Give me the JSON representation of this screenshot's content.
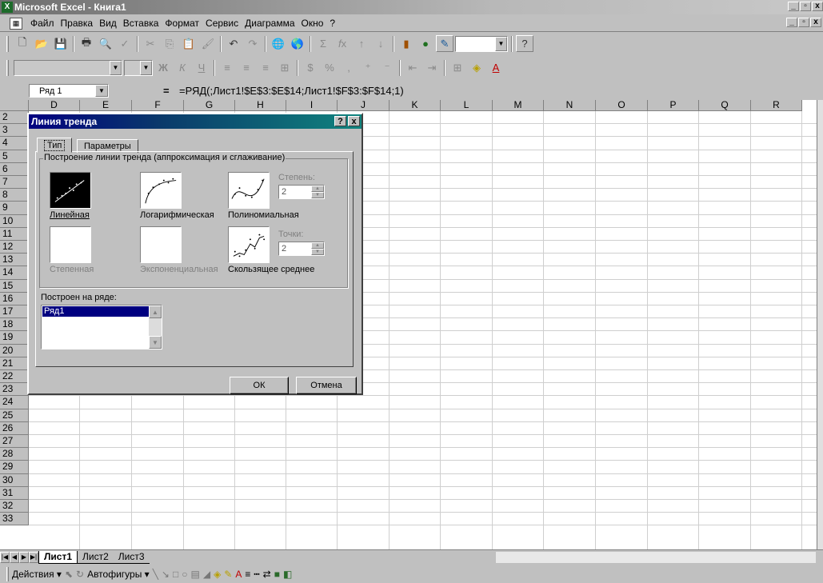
{
  "window": {
    "title": "Microsoft Excel - Книга1",
    "win_buttons": [
      "_",
      "▫",
      "x"
    ],
    "doc_buttons": [
      "_",
      "▫",
      "x"
    ]
  },
  "menu": [
    "Файл",
    "Правка",
    "Вид",
    "Вставка",
    "Формат",
    "Сервис",
    "Диаграмма",
    "Окно",
    "?"
  ],
  "formula_bar": {
    "name_box": "Ряд 1",
    "equals": "=",
    "formula": "=РЯД(;Лист1!$E$3:$E$14;Лист1!$F$3:$F$14;1)"
  },
  "toolbar2": {
    "bold": "Ж",
    "italic": "К",
    "underline": "Ч",
    "percent": "%",
    "comma": ","
  },
  "columns": [
    "D",
    "E",
    "F",
    "G",
    "H",
    "I",
    "J",
    "K",
    "L",
    "M",
    "N",
    "O",
    "P",
    "Q",
    "R"
  ],
  "rows": [
    "2",
    "3",
    "4",
    "5",
    "6",
    "7",
    "8",
    "9",
    "10",
    "11",
    "12",
    "13",
    "14",
    "15",
    "16",
    "17",
    "18",
    "19",
    "20",
    "21",
    "22",
    "23",
    "24",
    "25",
    "26",
    "27",
    "28",
    "29",
    "30",
    "31",
    "32",
    "33"
  ],
  "sheet_tabs": [
    "Лист1",
    "Лист2",
    "Лист3"
  ],
  "drawing_bar": {
    "actions": "Действия ▾",
    "autoshapes": "Автофигуры ▾"
  },
  "dialog": {
    "title": "Линия тренда",
    "help_btn": "?",
    "close_btn": "x",
    "tabs": [
      "Тип",
      "Параметры"
    ],
    "group_label": "Построение линии тренда (аппроксимация и сглаживание)",
    "types": [
      {
        "label": "Линейная",
        "selected": true,
        "enabled": true
      },
      {
        "label": "Логарифмическая",
        "selected": false,
        "enabled": true
      },
      {
        "label": "Полиномиальная",
        "selected": false,
        "enabled": true
      },
      {
        "label": "Степенная",
        "selected": false,
        "enabled": false
      },
      {
        "label": "Экспоненциальная",
        "selected": false,
        "enabled": false
      },
      {
        "label": "Скользящее среднее",
        "selected": false,
        "enabled": true
      }
    ],
    "degree": {
      "label": "Степень:",
      "value": "2"
    },
    "points": {
      "label": "Точки:",
      "value": "2"
    },
    "series_label": "Построен на ряде:",
    "series": [
      "Ряд1"
    ],
    "ok": "ОК",
    "cancel": "Отмена"
  }
}
